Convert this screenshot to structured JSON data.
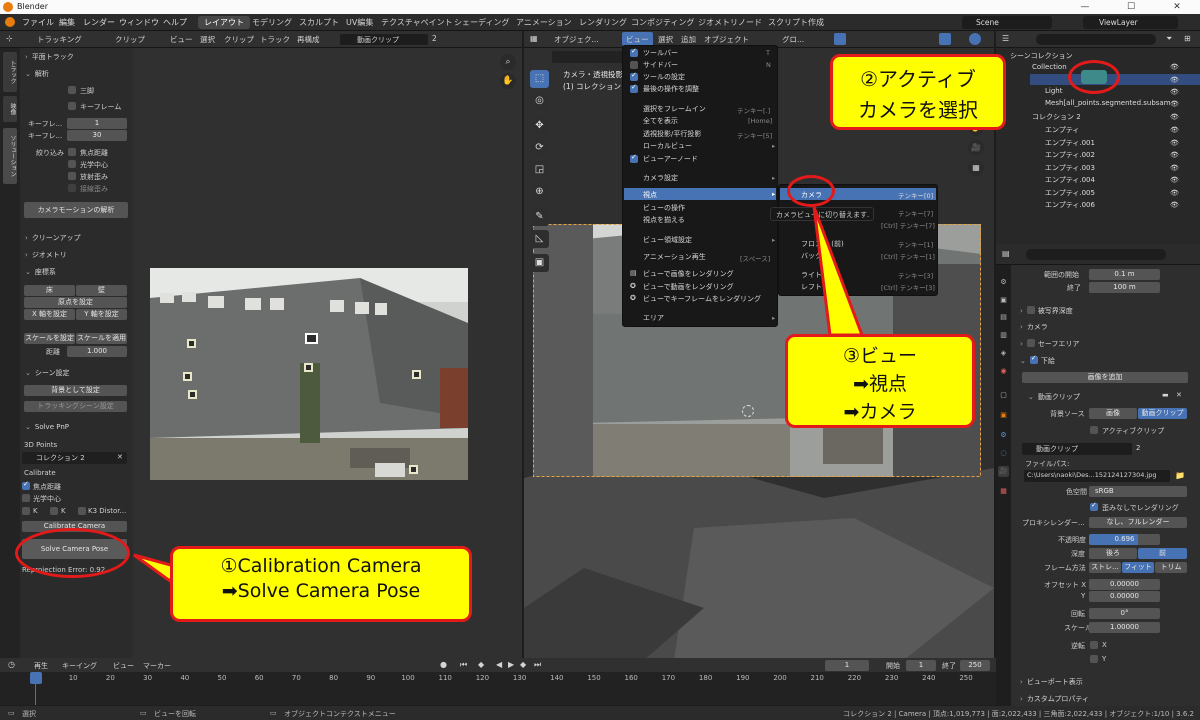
{
  "window": {
    "app_title": "Blender",
    "version": "3.6.2"
  },
  "menubar": {
    "items": [
      "ファイル",
      "編集",
      "レンダー",
      "ウィンドウ",
      "ヘルプ"
    ],
    "workspaces": [
      "レイアウト",
      "モデリング",
      "スカルプト",
      "UV編集",
      "テクスチャペイント",
      "シェーディング",
      "アニメーション",
      "レンダリング",
      "コンポジティング",
      "ジオメトリノード",
      "スクリプト作成"
    ],
    "scene": "Scene",
    "viewlayer": "ViewLayer"
  },
  "clip_header": {
    "mode": "トラッキング",
    "clip_menu": "クリップ",
    "menus": [
      "ビュー",
      "選択",
      "クリップ",
      "トラック",
      "再構成"
    ],
    "clip_name": "動画クリップ",
    "users": "2"
  },
  "clip_tabs": [
    "トラック",
    "映像",
    "ソリューション"
  ],
  "clip_panel": {
    "plane_track": "平面トラック",
    "solve": "解析",
    "tripod": "三脚",
    "keyframe": "キーフレーム",
    "keyframe_a_label": "キーフレ...",
    "keyframe_a": "1",
    "keyframe_b_label": "キーフレ...",
    "keyframe_b": "30",
    "refine": "絞り込み",
    "focal": "焦点距離",
    "optical_center": "光学中心",
    "radial": "放射歪み",
    "tangential": "接線歪み",
    "solve_btn": "カメラモーションの解析",
    "cleanup": "クリーンアップ",
    "geometry": "ジオメトリ",
    "orientation": "座標系",
    "floor": "床",
    "wall": "壁",
    "set_origin": "原点を設定",
    "x_axis": "X 軸を設定",
    "y_axis": "Y 軸を設定",
    "set_scale": "スケールを設定",
    "apply_scale": "スケールを適用",
    "distance_label": "距離",
    "distance": "1.000",
    "scene_setup": "シーン設定",
    "set_background": "背景として設定",
    "setup_tracking": "トラッキングシーン設定",
    "solve_pnp": "Solve PnP",
    "points_3d": "3D Points",
    "collection": "コレクション 2",
    "calibrate": "Calibrate",
    "focal2": "焦点距離",
    "optical2": "光学中心",
    "k1": "K",
    "k2": "K",
    "k3": "K3 Distor...",
    "calibrate_btn": "Calibrate Camera",
    "solve_pose_btn": "Solve Camera Pose",
    "reprojection": "Reprojection Error: 0.92"
  },
  "viewport": {
    "header": {
      "mode": "オブジェク...",
      "menus": [
        "ビュー",
        "選択",
        "追加",
        "オブジェクト"
      ],
      "orientation": "グロ..."
    },
    "info_line1": "カメラ・透視投影",
    "info_line2": "(1) コレクション 2 | カメラ"
  },
  "view_menu": {
    "items": [
      "ツールバー",
      "サイドバー",
      "ツールの設定",
      "最後の操作を調整",
      "選択をフレームイン",
      "全てを表示",
      "透視投影/平行投影",
      "ローカルビュー",
      "ビューアーノード",
      "カメラ設定",
      "視点",
      "ビューの操作",
      "視点を揃える",
      "ビュー領域設定",
      "アニメーション再生",
      "ビューで画像をレンダリング",
      "ビューで動画をレンダリング",
      "ビューでキーフレームをレンダリング",
      "エリア"
    ],
    "shortcuts": [
      "T",
      "N",
      "テンキー[.]",
      "[Home]",
      "テンキー[5]",
      "テンキー[/]",
      "[スペース]"
    ]
  },
  "viewpoint_submenu": {
    "items": [
      "カメラ",
      "フロント (前)",
      "バック",
      "ライト",
      "レフト"
    ],
    "shortcuts": [
      "テンキー[0]",
      "テンキー[1]",
      "[Ctrl] テンキー[1]",
      "テンキー[3]",
      "[Ctrl] テンキー[3]"
    ],
    "extra_shortcuts": [
      "テンキー[7]",
      "[Ctrl] テンキー[7]"
    ],
    "tooltip": "カメラビューに切り替えます."
  },
  "outliner": {
    "root": "シーンコレクション",
    "items": [
      "Collection",
      "Light",
      "Mesh[all_points.segmented.subsam",
      "コレクション 2",
      "エンプティ",
      "エンプティ.001",
      "エンプティ.002",
      "エンプティ.003",
      "エンプティ.004",
      "エンプティ.005",
      "エンプティ.006"
    ]
  },
  "properties": {
    "range_start_label": "範囲の開始",
    "range_start": "0.1 m",
    "range_end_label": "終了",
    "range_end": "100 m",
    "dof": "被写界深度",
    "camera": "カメラ",
    "safe_areas": "セーフエリア",
    "background": "下絵",
    "add_image": "画像を追加",
    "movie_clip": "動画クリップ",
    "bg_source_label": "背景ソース",
    "bg_image": "画像",
    "bg_movie": "動画クリップ",
    "active_clip": "アクティブクリップ",
    "clip_name": "動画クリップ",
    "clip_users": "2",
    "filepath_label": "ファイルパス:",
    "filepath": "C:\\Users\\naoki\\Des...152124127304.jpg",
    "colorspace_label": "色空間",
    "colorspace": "sRGB",
    "undistorted": "歪みなしでレンダリング",
    "proxy_label": "プロキシレンダー...",
    "proxy": "なし、フルレンダー",
    "opacity_label": "不透明度",
    "opacity": "0.696",
    "opacity_fraction": 0.696,
    "depth_label": "深度",
    "depth_back": "後ろ",
    "depth_front": "前",
    "frame_method_label": "フレーム方法",
    "frame_stretch": "ストレ...",
    "frame_fit": "フィット",
    "frame_crop": "トリム",
    "offset_x_label": "オフセット X",
    "offset_x": "0.00000",
    "offset_y_label": "Y",
    "offset_y": "0.00000",
    "rotation_label": "回転",
    "rotation": "0°",
    "scale_label": "スケール",
    "scale": "1.00000",
    "flip_label": "逆転",
    "flip_x": "X",
    "flip_y": "Y",
    "viewport_display": "ビューポート表示",
    "custom_props": "カスタムプロパティ"
  },
  "timeline": {
    "menus": [
      "再生",
      "キーイング",
      "ビュー",
      "マーカー"
    ],
    "current_frame": "1",
    "start_label": "開始",
    "start": "1",
    "end_label": "終了",
    "end": "250",
    "ticks": [
      "1",
      "10",
      "20",
      "30",
      "40",
      "50",
      "60",
      "70",
      "80",
      "90",
      "100",
      "110",
      "120",
      "130",
      "140",
      "150",
      "160",
      "170",
      "180",
      "190",
      "200",
      "210",
      "220",
      "230",
      "240",
      "250"
    ]
  },
  "statusbar": {
    "left": [
      "選択",
      "ビューを回転",
      "オブジェクトコンテクストメニュー"
    ],
    "right": "コレクション 2 | Camera | 頂点:1,019,773 | 面:2,022,433 | 三角面:2,022,433 | オブジェクト:1/10 | 3.6.2"
  },
  "callouts": {
    "c1": [
      "①Calibration Camera",
      "➡Solve Camera Pose"
    ],
    "c2": [
      "②アクティブ",
      "カメラを選択"
    ],
    "c3": [
      "③ビュー",
      "➡視点",
      "➡カメラ"
    ]
  },
  "colors": {
    "accent": "#4772b3",
    "callout_fill": "#ffff00",
    "callout_border": "#e21a1a",
    "blender_orange": "#e87d0d"
  }
}
